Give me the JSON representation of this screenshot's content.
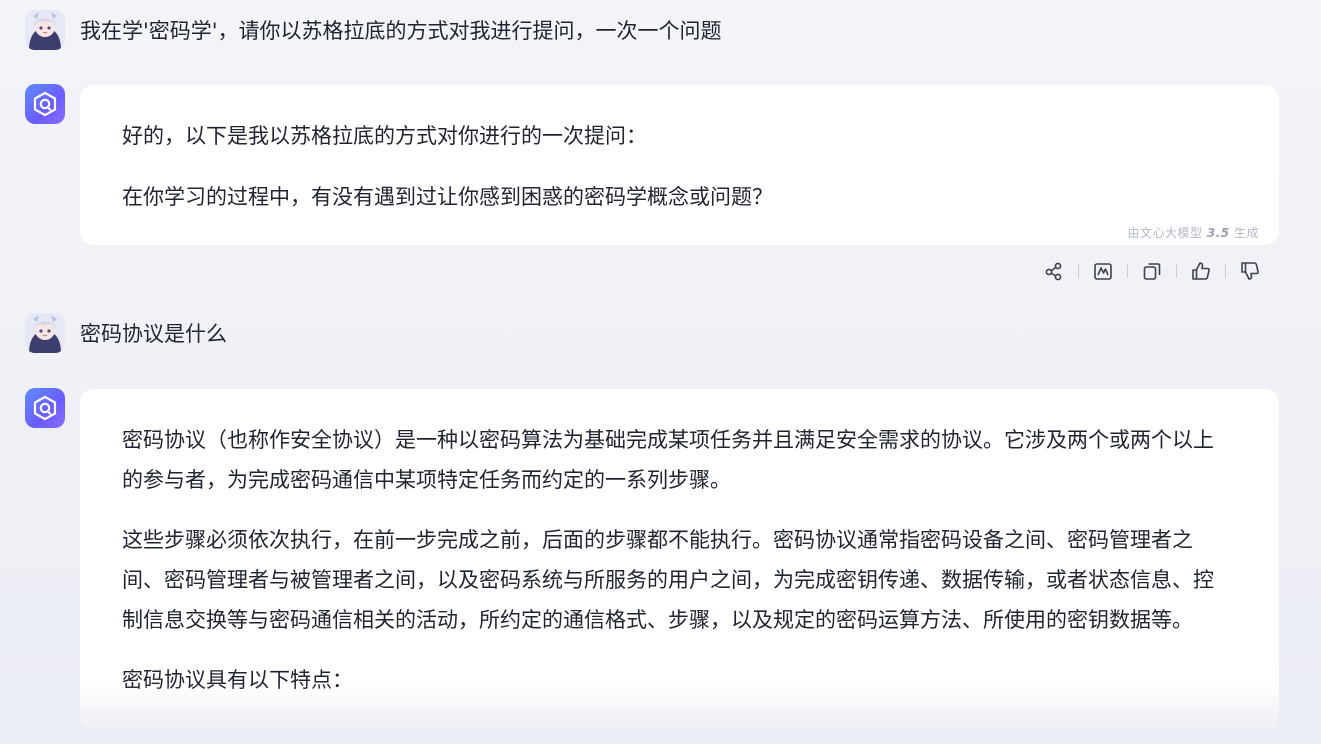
{
  "conversation": {
    "turn1": {
      "user_text": "我在学'密码学'，请你以苏格拉底的方式对我进行提问，一次一个问题",
      "assistant": {
        "paragraphs": [
          "好的，以下是我以苏格拉底的方式对你进行的一次提问：",
          "在你学习的过程中，有没有遇到过让你感到困惑的密码学概念或问题？"
        ],
        "generated_prefix": "由文心大模型",
        "generated_version": "3.5",
        "generated_suffix": "生成"
      }
    },
    "turn2": {
      "user_text": "密码协议是什么",
      "assistant": {
        "paragraphs": [
          "密码协议（也称作安全协议）是一种以密码算法为基础完成某项任务并且满足安全需求的协议。它涉及两个或两个以上的参与者，为完成密码通信中某项特定任务而约定的一系列步骤。",
          "这些步骤必须依次执行，在前一步完成之前，后面的步骤都不能执行。密码协议通常指密码设备之间、密码管理者之间、密码管理者与被管理者之间，以及密码系统与所服务的用户之间，为完成密钥传递、数据传输，或者状态信息、控制信息交换等与密码通信相关的活动，所约定的通信格式、步骤，以及规定的密码运算方法、所使用的密钥数据等。",
          "密码协议具有以下特点："
        ]
      }
    }
  },
  "actions": [
    "share-icon",
    "chart-icon",
    "copy-icon",
    "thumbs-up-icon",
    "thumbs-down-icon"
  ],
  "colors": {
    "accent": "#6b5cff",
    "background": "#eef0f6",
    "text": "#1f2430",
    "muted": "#b3b8c6"
  }
}
